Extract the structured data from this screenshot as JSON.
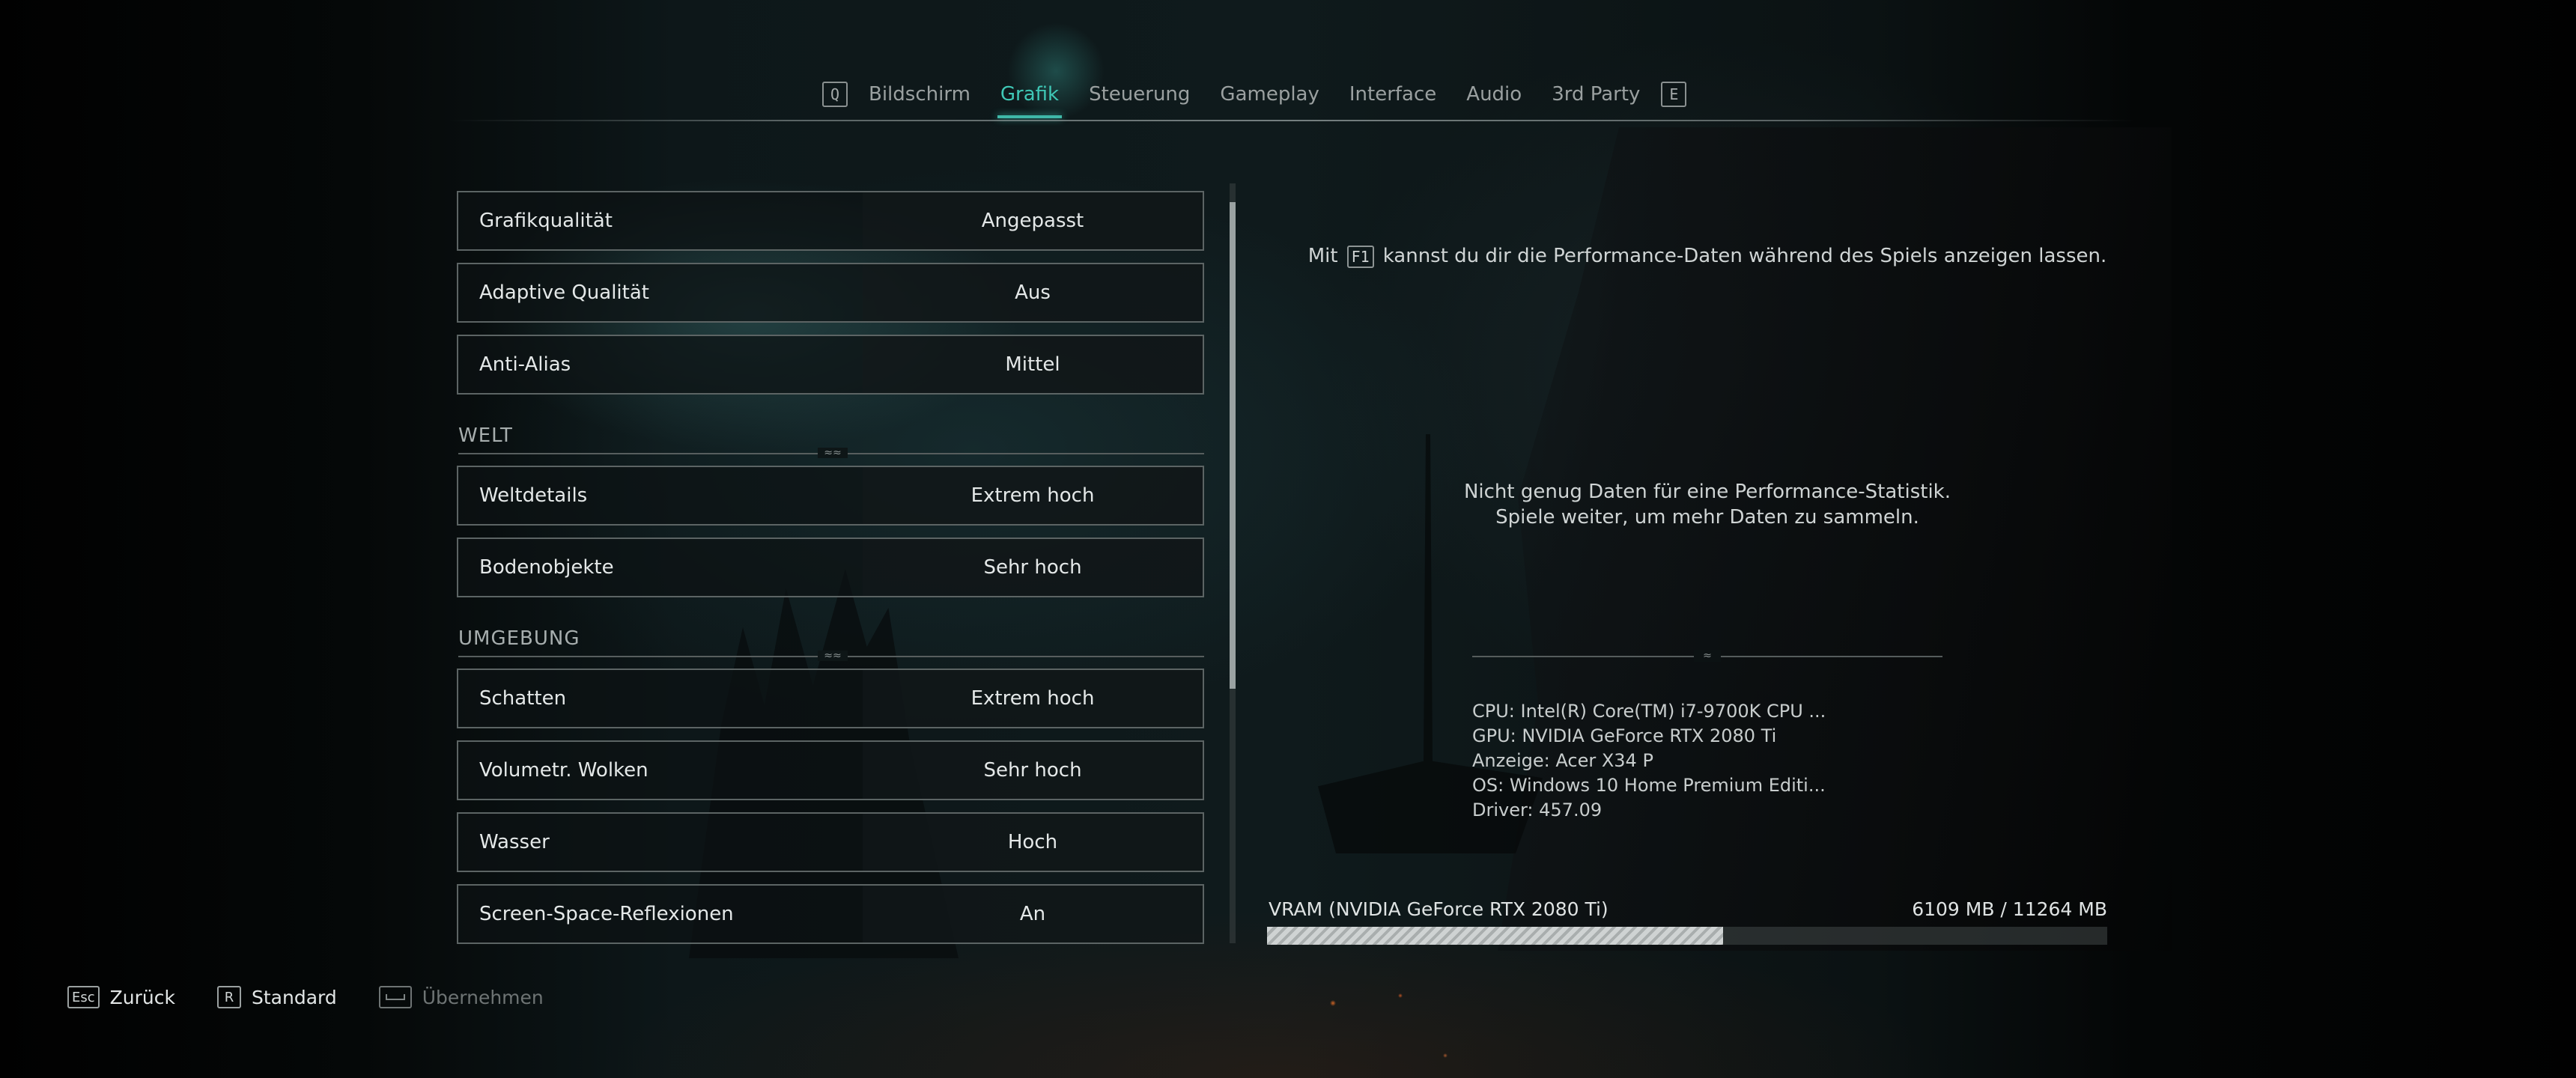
{
  "tabs": {
    "left_key": "Q",
    "right_key": "E",
    "items": [
      {
        "label": "Bildschirm",
        "active": false
      },
      {
        "label": "Grafik",
        "active": true
      },
      {
        "label": "Steuerung",
        "active": false
      },
      {
        "label": "Gameplay",
        "active": false
      },
      {
        "label": "Interface",
        "active": false
      },
      {
        "label": "Audio",
        "active": false
      },
      {
        "label": "3rd Party",
        "active": false
      }
    ]
  },
  "settings": {
    "general": [
      {
        "label": "Grafikqualität",
        "value": "Angepasst"
      },
      {
        "label": "Adaptive Qualität",
        "value": "Aus"
      },
      {
        "label": "Anti-Alias",
        "value": "Mittel"
      }
    ],
    "sections": [
      {
        "title": "WELT",
        "rows": [
          {
            "label": "Weltdetails",
            "value": "Extrem hoch"
          },
          {
            "label": "Bodenobjekte",
            "value": "Sehr hoch"
          }
        ]
      },
      {
        "title": "UMGEBUNG",
        "rows": [
          {
            "label": "Schatten",
            "value": "Extrem hoch"
          },
          {
            "label": "Volumetr. Wolken",
            "value": "Sehr hoch"
          },
          {
            "label": "Wasser",
            "value": "Hoch"
          },
          {
            "label": "Screen-Space-Reflexionen",
            "value": "An"
          }
        ]
      }
    ],
    "scroll_fraction": 0.64
  },
  "info_panel": {
    "f1_prefix": "Mit",
    "f1_key": "F1",
    "f1_suffix": "kannst du dir die Performance-Daten während des Spiels anzeigen lassen.",
    "perf_line1": "Nicht genug Daten für eine Performance-Statistik.",
    "perf_line2": "Spiele weiter, um mehr Daten zu sammeln.",
    "system": {
      "cpu": "CPU: Intel(R) Core(TM) i7-9700K CPU ...",
      "gpu": "GPU: NVIDIA GeForce RTX 2080 Ti",
      "display": "Anzeige: Acer X34 P",
      "os": "OS: Windows 10 Home Premium Editi...",
      "driver": "Driver: 457.09"
    },
    "vram": {
      "label": "VRAM (NVIDIA GeForce RTX 2080 Ti)",
      "value_text": "6109 MB / 11264 MB",
      "used_mb": 6109,
      "total_mb": 11264
    }
  },
  "bottom_hints": [
    {
      "key": "Esc",
      "label": "Zurück",
      "enabled": true
    },
    {
      "key": "R",
      "label": "Standard",
      "enabled": true
    },
    {
      "key": "",
      "label": "Übernehmen",
      "enabled": false
    }
  ],
  "colors": {
    "accent": "#3fc8b6",
    "text": "#e4e8e8",
    "muted": "#9aa0a0"
  }
}
